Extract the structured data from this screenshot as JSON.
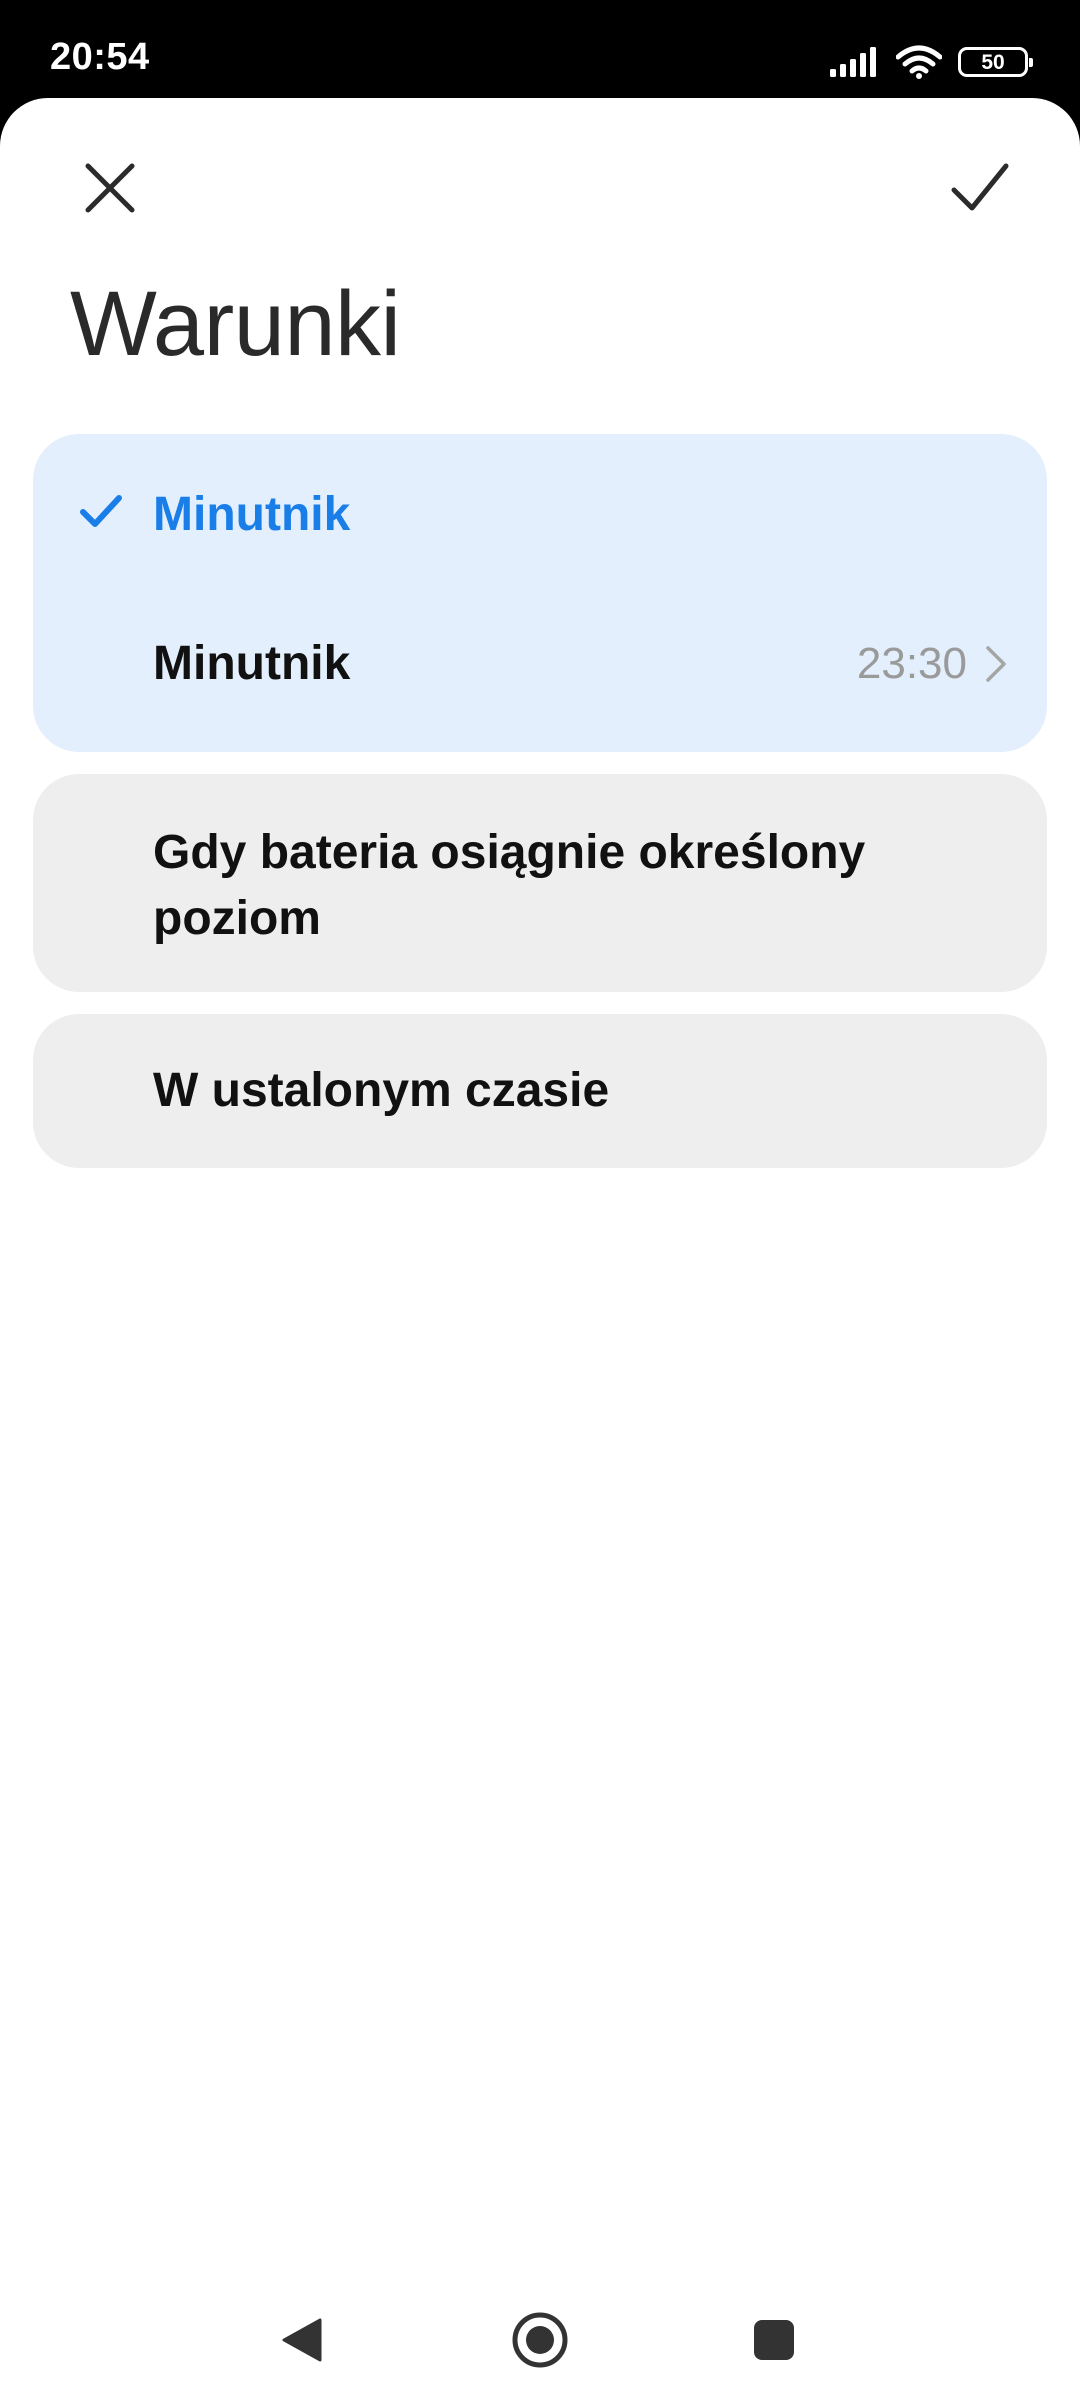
{
  "status_bar": {
    "time": "20:54",
    "battery_level": "50",
    "icons": [
      "signal-icon",
      "wifi-icon",
      "battery-icon"
    ]
  },
  "header": {
    "close_icon": "close-icon",
    "confirm_icon": "check-icon",
    "title": "Warunki"
  },
  "options": {
    "selected": {
      "title": "Minutnik",
      "selected": true,
      "row": {
        "label": "Minutnik",
        "value": "23:30",
        "icon": "chevron-right-icon"
      }
    },
    "battery": {
      "title": "Gdy bateria osiągnie określony poziom"
    },
    "scheduled": {
      "title": "W ustalonym czasie"
    }
  },
  "nav": {
    "icons": [
      "back-icon",
      "home-icon",
      "recents-icon"
    ]
  },
  "colors": {
    "accent": "#1a7ee8",
    "selected_card_bg": "#e3effd",
    "card_bg": "#eeeeee"
  }
}
